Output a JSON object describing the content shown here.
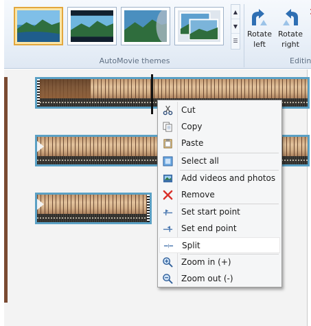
{
  "ribbon": {
    "themes_group_label": "AutoMovie themes",
    "editing_group_label": "Editing",
    "rotate_left": [
      "Rotate",
      "left"
    ],
    "rotate_right": [
      "Rotate",
      "right"
    ]
  },
  "context_menu": {
    "items": [
      {
        "label": "Cut",
        "icon": "scissors-icon"
      },
      {
        "label": "Copy",
        "icon": "copy-icon"
      },
      {
        "label": "Paste",
        "icon": "paste-icon"
      },
      {
        "label": "Select all",
        "icon": "select-all-icon"
      },
      {
        "label": "Add videos and photos",
        "icon": "add-media-icon"
      },
      {
        "label": "Remove",
        "icon": "remove-x-icon"
      },
      {
        "label": "Set start point",
        "icon": "start-point-icon"
      },
      {
        "label": "Set end point",
        "icon": "end-point-icon"
      },
      {
        "label": "Split",
        "icon": "split-icon",
        "highlighted": true
      },
      {
        "label": "Zoom in (+)",
        "icon": "zoom-in-icon"
      },
      {
        "label": "Zoom out (-)",
        "icon": "zoom-out-icon"
      }
    ]
  },
  "colors": {
    "selection_border": "#e2a73d",
    "clip_border": "#5aa0c4",
    "remove_red": "#d9312b"
  }
}
